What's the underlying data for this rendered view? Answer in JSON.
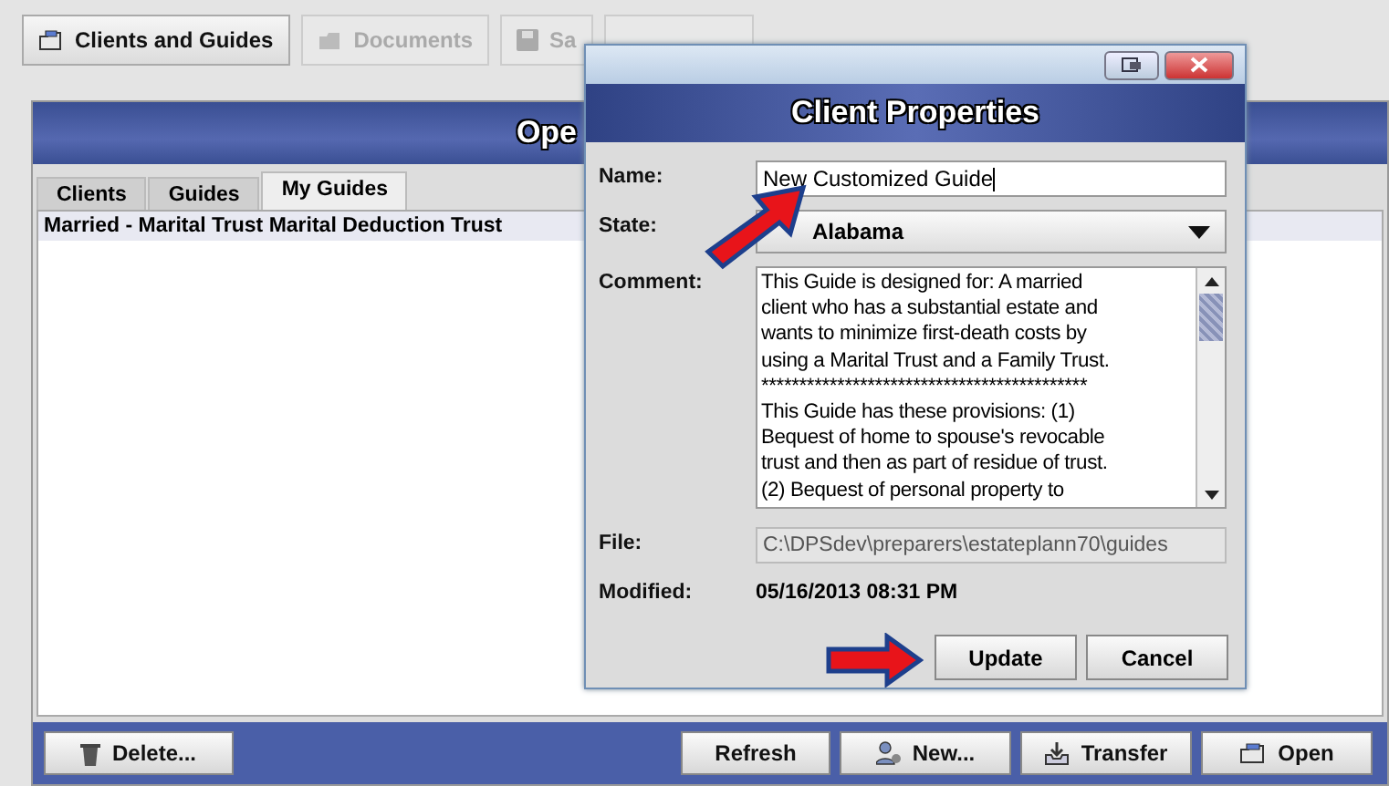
{
  "toolbar": {
    "buttons": [
      {
        "label": "Clients and Guides",
        "kind": "clients",
        "disabled": false
      },
      {
        "label": "Documents",
        "kind": "documents",
        "disabled": true
      },
      {
        "label": "Sa",
        "kind": "save",
        "disabled": true
      }
    ]
  },
  "panel": {
    "title": "Ope",
    "tabs": [
      {
        "label": "Clients",
        "selected": false
      },
      {
        "label": "Guides",
        "selected": false
      },
      {
        "label": "My Guides",
        "selected": true
      }
    ],
    "rows": [
      {
        "text": "Married - Marital Trust Marital Deduction Trust",
        "selected": true
      }
    ],
    "left_buttons": [
      {
        "label": "Delete...",
        "kind": "delete"
      }
    ],
    "right_buttons": [
      {
        "label": "Refresh",
        "kind": "none"
      },
      {
        "label": "New...",
        "kind": "new"
      },
      {
        "label": "Transfer",
        "kind": "transfer"
      },
      {
        "label": "Open",
        "kind": "open"
      }
    ]
  },
  "dialog": {
    "title": "Client Properties",
    "name": {
      "label": "Name:",
      "value": "New Customized Guide"
    },
    "state": {
      "label": "State:",
      "value": "Alabama"
    },
    "comment": {
      "label": "Comment:",
      "lines": [
        "This Guide is designed for:  A married",
        "client who has a substantial estate and",
        "wants to minimize first-death costs by",
        "using a Marital Trust and a Family Trust.",
        "*******************************************",
        "This Guide has these provisions:  (1)",
        "Bequest of home to spouse's revocable",
        "trust and then as part of residue of trust.",
        "(2) Bequest of personal property to"
      ]
    },
    "file": {
      "label": "File:",
      "value": "C:\\DPSdev\\preparers\\estateplann70\\guides"
    },
    "modified": {
      "label": "Modified:",
      "value": "05/16/2013 08:31 PM"
    },
    "buttons": [
      "Update",
      "Cancel"
    ]
  }
}
